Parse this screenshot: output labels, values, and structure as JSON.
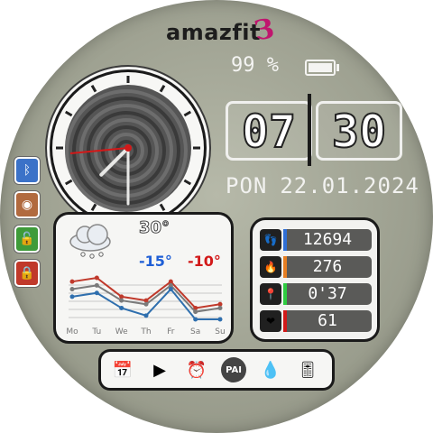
{
  "brand": {
    "text": "amazfit",
    "mark": "З"
  },
  "battery": {
    "percent_text": "99 %",
    "level": 0.99
  },
  "time": {
    "hour": "07",
    "minute": "30"
  },
  "date": {
    "day": "PON",
    "date": "22.01.2024"
  },
  "side_buttons": [
    {
      "icon": "bluetooth-icon",
      "glyph": "ᛒ",
      "color": "#3b72c8"
    },
    {
      "icon": "do-not-disturb-icon",
      "glyph": "◉",
      "color": "#b16a3f"
    },
    {
      "icon": "unlock-icon",
      "glyph": "🔓",
      "color": "#3e9b3a"
    },
    {
      "icon": "lock-icon",
      "glyph": "🔒",
      "color": "#c0392b"
    }
  ],
  "weather": {
    "current_temp": "30°",
    "low": "-15°",
    "high": "-10°",
    "low_color": "#1f5fd6",
    "high_color": "#d21919",
    "forecast_days": [
      "Mo",
      "Tu",
      "We",
      "Th",
      "Fr",
      "Sa",
      "Su"
    ],
    "series": [
      {
        "name": "high",
        "color": "#c0392b",
        "values": [
          4,
          5,
          0,
          -1,
          4,
          -3,
          -2
        ]
      },
      {
        "name": "mid",
        "color": "#7a7a7a",
        "values": [
          2,
          3,
          -1,
          -2,
          3,
          -4,
          -3
        ]
      },
      {
        "name": "low",
        "color": "#2f6fae",
        "values": [
          0,
          1,
          -3,
          -5,
          2,
          -6,
          -6
        ]
      }
    ]
  },
  "stats": [
    {
      "icon": "steps-icon",
      "glyph": "👣",
      "value": "12694",
      "bar_color": "#2f6fd6"
    },
    {
      "icon": "calories-icon",
      "glyph": "🔥",
      "value": "276",
      "bar_color": "#e67e22"
    },
    {
      "icon": "distance-icon",
      "glyph": "📍",
      "value": "0'37",
      "bar_color": "#2ecc40"
    },
    {
      "icon": "heart-rate-icon",
      "glyph": "❤",
      "value": "61",
      "bar_color": "#d21919"
    }
  ],
  "dock": [
    {
      "icon": "calendar-icon",
      "glyph": "📅"
    },
    {
      "icon": "music-player-icon",
      "glyph": "▶"
    },
    {
      "icon": "alarm-icon",
      "glyph": "⏰"
    },
    {
      "icon": "pai-icon",
      "glyph": "PAI"
    },
    {
      "icon": "stress-icon",
      "glyph": "💧"
    },
    {
      "icon": "settings-sliders-icon",
      "glyph": "🎚"
    }
  ]
}
